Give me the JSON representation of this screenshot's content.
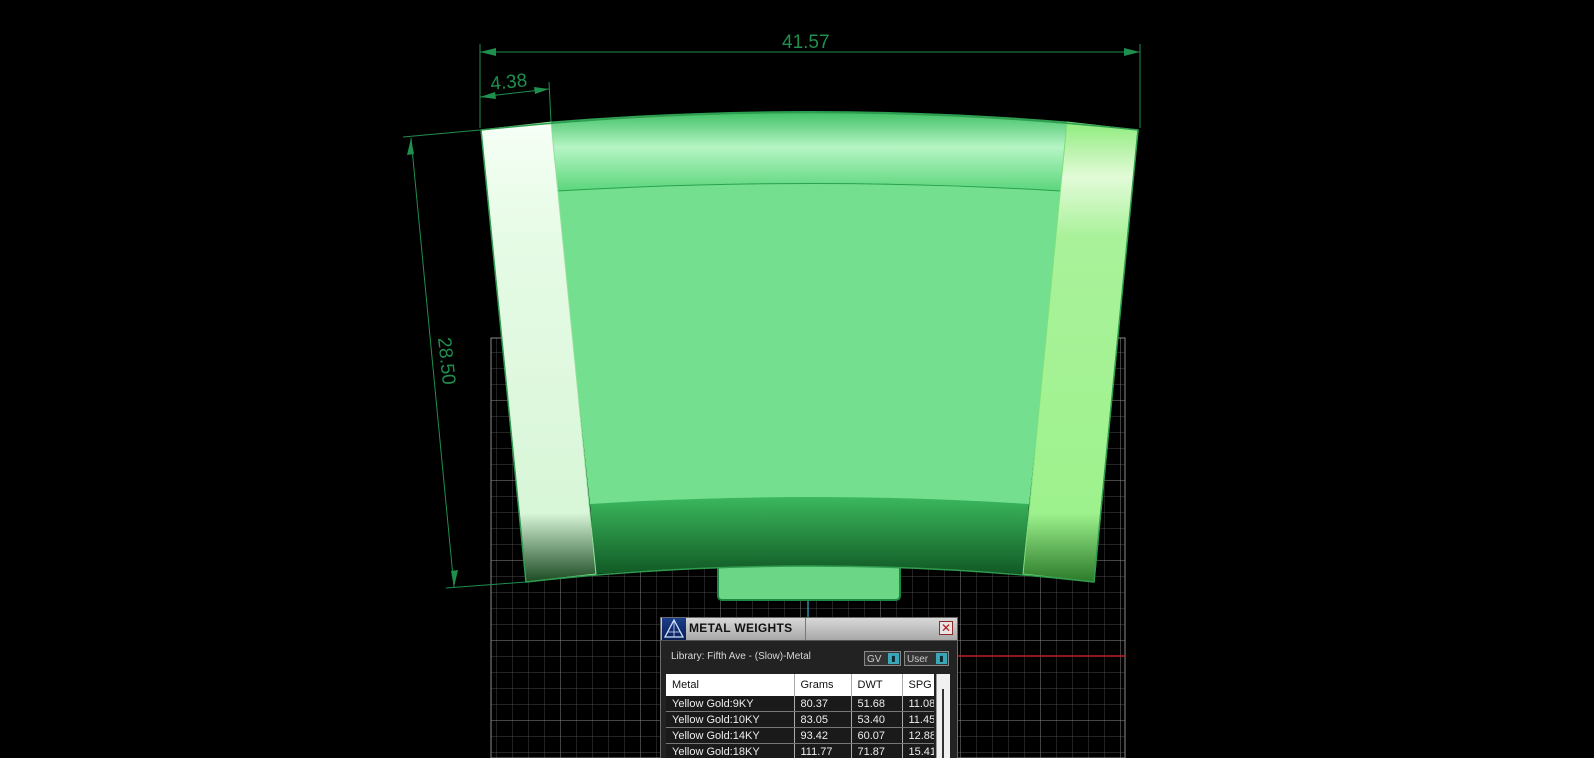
{
  "dimensions": {
    "width_label": "41.57",
    "side_label": "4.38",
    "height_label": "28.50"
  },
  "colors": {
    "background": "#000000",
    "dimension_line": "#1f8f4e",
    "grid": "#6a6a6a",
    "model_green": "#74e08f",
    "axis_red": "#c02020"
  },
  "metal_weights": {
    "title": "METAL WEIGHTS",
    "logo_icon": "pyramid-logo-icon",
    "close_icon": "close-icon",
    "close_glyph": "✕",
    "library_label": "Library: Fifth Ave - (Slow)-Metal",
    "dropdown_1": "GV",
    "dropdown_2": "User",
    "columns": {
      "metal": "Metal",
      "grams": "Grams",
      "dwt": "DWT",
      "spg": "SPG"
    },
    "rows": [
      {
        "metal": "Yellow Gold:9KY",
        "grams": "80.37",
        "dwt": "51.68",
        "spg": "11.08"
      },
      {
        "metal": "Yellow Gold:10KY",
        "grams": "83.05",
        "dwt": "53.40",
        "spg": "11.45"
      },
      {
        "metal": "Yellow Gold:14KY",
        "grams": "93.42",
        "dwt": "60.07",
        "spg": "12.88"
      },
      {
        "metal": "Yellow Gold:18KY",
        "grams": "111.77",
        "dwt": "71.87",
        "spg": "15.41"
      }
    ]
  }
}
